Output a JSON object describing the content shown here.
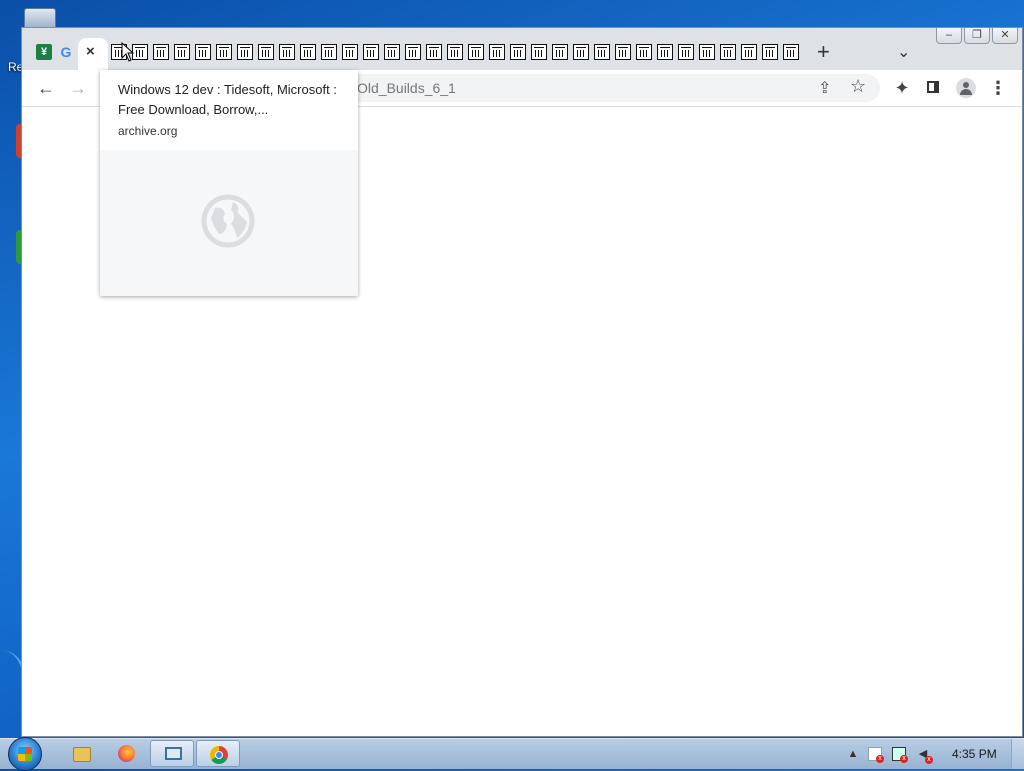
{
  "desktop": {
    "recycle_bin_label": "Re"
  },
  "browser": {
    "caption": {
      "minimize": "–",
      "restore": "❐",
      "close": "✕"
    },
    "tabs": {
      "active_close": "×",
      "archive_tab_count": 33,
      "new_tab": "+",
      "tab_search": "⌄"
    },
    "toolbar": {
      "back": "←",
      "forward": "→",
      "url_visible": "Old_Builds_6_1",
      "share": "⇪",
      "bookmark": "☆",
      "extensions": "✦",
      "menu": "⋮"
    },
    "hover_card": {
      "title": "Windows 12 dev : Tidesoft, Microsoft : Free Download, Borrow,...",
      "domain": "archive.org"
    }
  },
  "taskbar": {
    "clock": "4:35 PM",
    "tray_up": "▲"
  },
  "colors": {
    "desktop": "#1a78d6",
    "tab_strip": "#dee1e6",
    "omnibox": "#f1f3f4",
    "sheets_green": "#1e7e45"
  }
}
